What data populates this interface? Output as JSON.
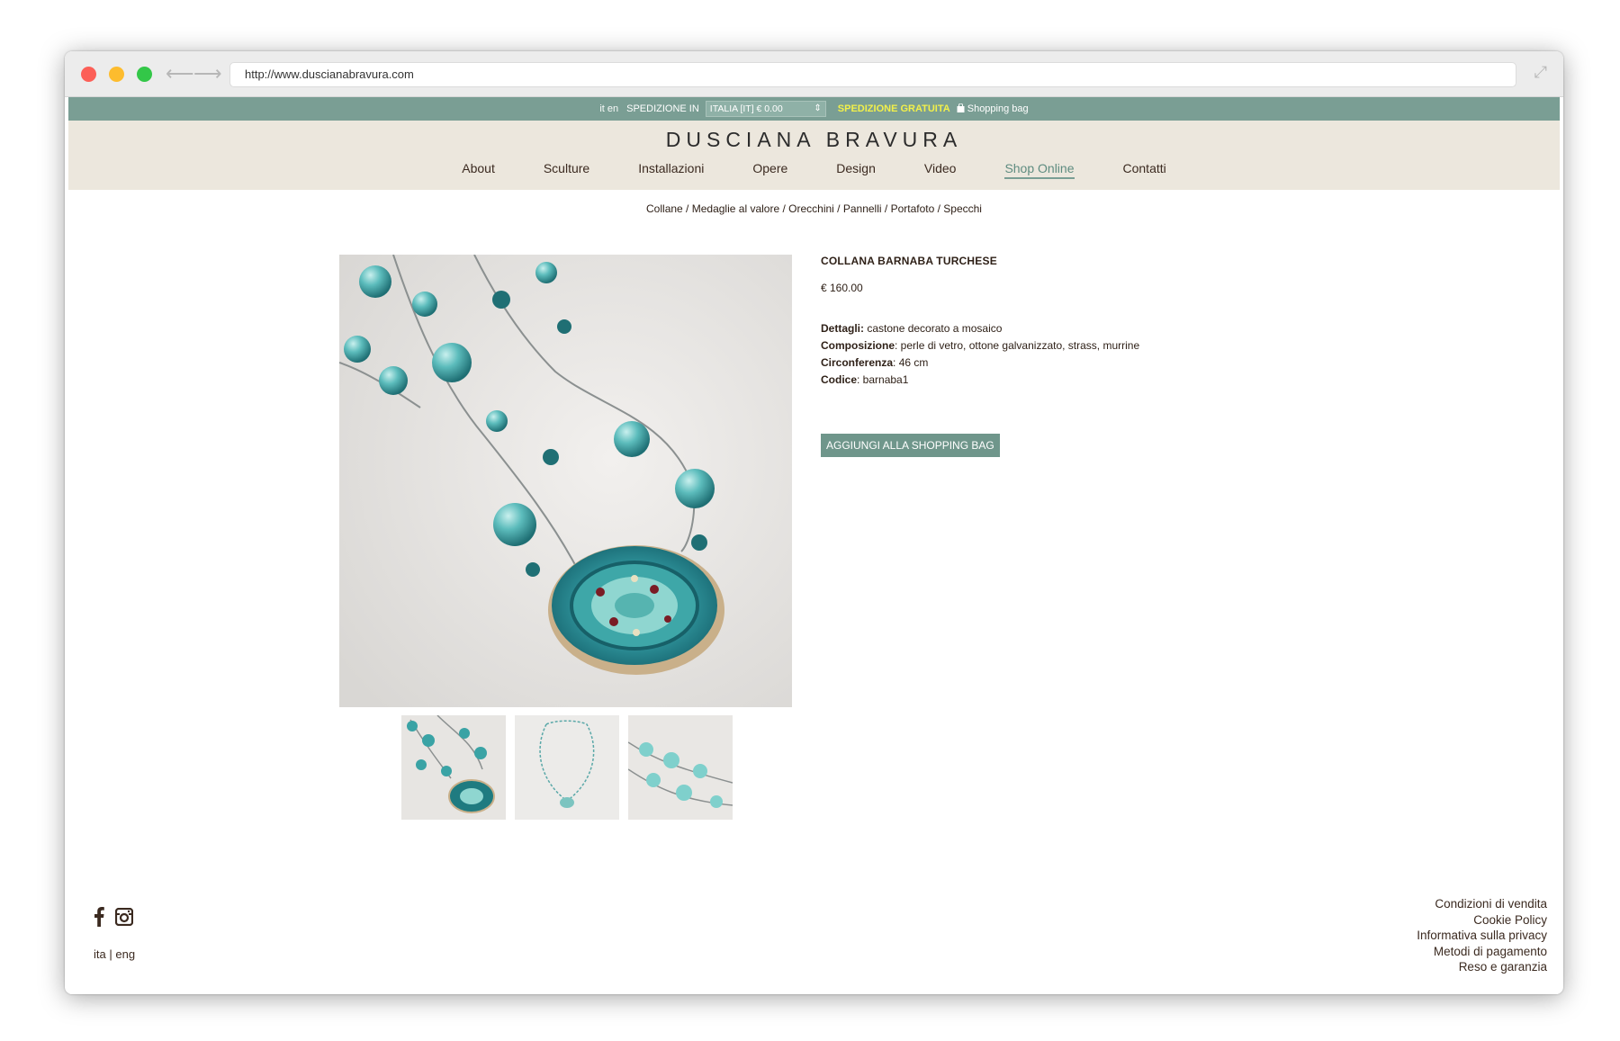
{
  "browser": {
    "url": "http://www.duscianabravura.com"
  },
  "topbar": {
    "lang_it": "it",
    "lang_en": "en",
    "shipping_label": "SPEDIZIONE IN",
    "shipping_select": "ITALIA [IT] € 0.00",
    "free_shipping": "SPEDIZIONE GRATUITA",
    "shopping_bag": "Shopping bag"
  },
  "header": {
    "logo": "DUSCIANA BRAVURA"
  },
  "nav": {
    "items": [
      "About",
      "Sculture",
      "Installazioni",
      "Opere",
      "Design",
      "Video",
      "Shop Online",
      "Contatti"
    ],
    "active": "Shop Online"
  },
  "categories": [
    "Collane",
    "Medaglie al valore",
    "Orecchini",
    "Pannelli",
    "Portafoto",
    "Specchi"
  ],
  "product": {
    "title": "COLLANA BARNABA TURCHESE",
    "price": "€ 160.00",
    "details": [
      {
        "label": "Dettagli:",
        "value": " castone decorato a mosaico"
      },
      {
        "label": "Composizione",
        "value": ": perle di vetro, ottone galvanizzato, strass, murrine"
      },
      {
        "label": "Circonferenza",
        "value": ": 46 cm"
      },
      {
        "label": "Codice",
        "value": ": barnaba1"
      }
    ],
    "add_button": "AGGIUNGI ALLA SHOPPING BAG"
  },
  "footer": {
    "lang_ita": "ita",
    "lang_sep": "|",
    "lang_eng": "eng",
    "links": [
      "Condizioni di vendita",
      "Cookie Policy",
      "Informativa sulla privacy",
      "Metodi di pagamento",
      "Reso e garanzia"
    ]
  },
  "colors": {
    "accent": "#7a9e94",
    "header_bg": "#ece7dd",
    "free_shipping": "#f2f04a",
    "text": "#3b2a20"
  },
  "icons": [
    "back-arrow-icon",
    "forward-arrow-icon",
    "expand-icon",
    "bag-icon",
    "facebook-icon",
    "instagram-icon"
  ]
}
